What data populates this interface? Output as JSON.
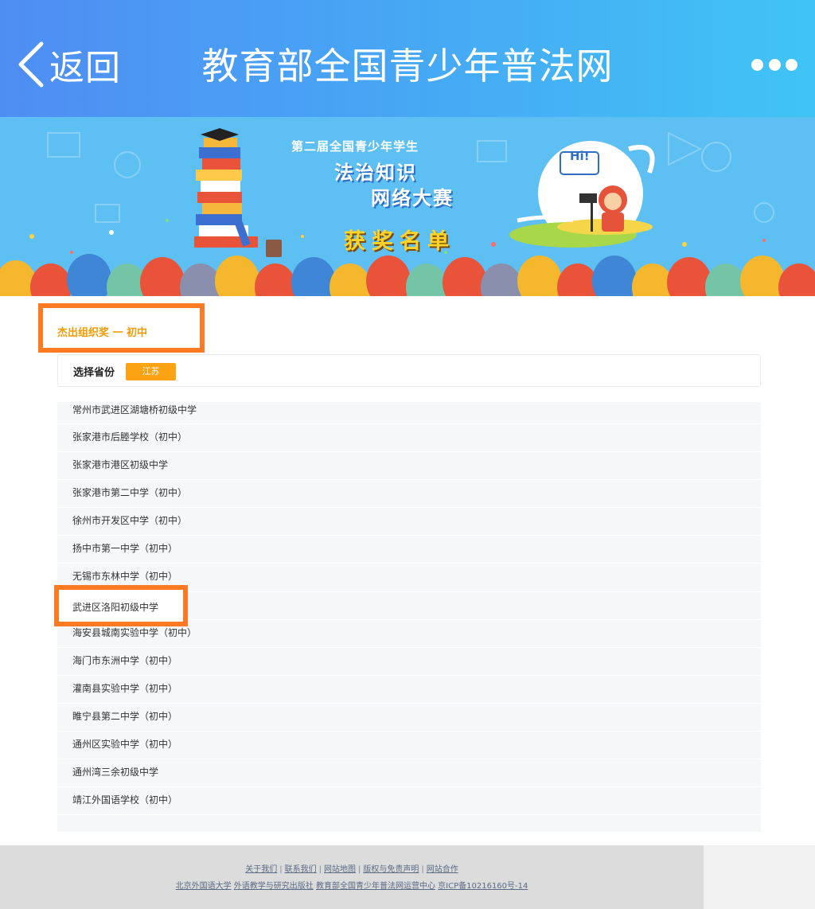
{
  "header": {
    "back_label": "返回",
    "title": "教育部全国青少年普法网"
  },
  "banner": {
    "line1": "第二届全国青少年学生",
    "line2": "法治知识",
    "line3": "网络大赛",
    "award": "获奖名单",
    "hi": "Hi!"
  },
  "section": {
    "title": "杰出组织奖 一 初中",
    "province_label": "选择省份",
    "province_value": "江苏"
  },
  "schools": [
    "常州市武进区湖塘桥初级中学",
    "张家港市后塍学校（初中）",
    "张家港市港区初级中学",
    "张家港市第二中学（初中）",
    "徐州市开发区中学（初中）",
    "扬中市第一中学（初中）",
    "无锡市东林中学（初中）",
    "武进区洛阳初级中学",
    "海安县城南实验中学（初中）",
    "海门市东洲中学（初中）",
    "灌南县实验中学（初中）",
    "睢宁县第二中学（初中）",
    "通州区实验中学（初中）",
    "通州湾三余初级中学",
    "靖江外国语学校（初中）"
  ],
  "footer": {
    "links1": [
      "关于我们",
      "联系我们",
      "网站地图",
      "版权与免责声明",
      "网站合作"
    ],
    "links2": [
      "北京外国语大学",
      "外语教学与研究出版社",
      "教育部全国青少年普法网运营中心",
      "京ICP备10216160号-14"
    ]
  },
  "colors": {
    "nav_gradient_start": "#4f8df3",
    "nav_gradient_end": "#40c4f5",
    "highlight_border": "#ff7a22",
    "section_title": "#f29b05",
    "province_button": "#fba312"
  }
}
